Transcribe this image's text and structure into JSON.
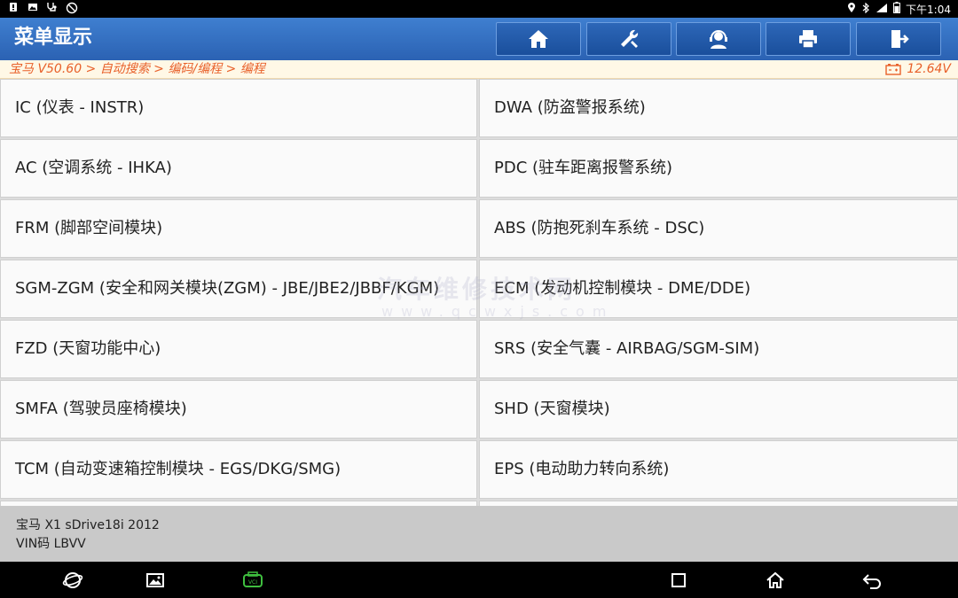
{
  "statusbar": {
    "left_icons": [
      "alert-icon",
      "image-icon",
      "stethoscope-icon",
      "no-disturb-icon"
    ],
    "time": "下午1:04"
  },
  "header": {
    "title": "菜单显示",
    "buttons": [
      {
        "name": "home-button",
        "icon": "home-icon"
      },
      {
        "name": "diagnose-tools-button",
        "icon": "tools-icon"
      },
      {
        "name": "support-button",
        "icon": "headset-icon"
      },
      {
        "name": "print-button",
        "icon": "printer-icon"
      },
      {
        "name": "exit-button",
        "icon": "exit-icon"
      }
    ]
  },
  "breadcrumb": {
    "path": "宝马 V50.60 > 自动搜索 > 编码/编程 > 编程",
    "voltage": "12.64V"
  },
  "menu": {
    "items": [
      {
        "left": "IC (仪表 - INSTR)",
        "right": "DWA (防盗警报系统)"
      },
      {
        "left": "AC (空调系统 - IHKA)",
        "right": "PDC (驻车距离报警系统)"
      },
      {
        "left": "FRM (脚部空间模块)",
        "right": "ABS (防抱死刹车系统 - DSC)"
      },
      {
        "left": "SGM-ZGM (安全和网关模块(ZGM) - JBE/JBE2/JBBF/KGM)",
        "right": "ECM (发动机控制模块 - DME/DDE)"
      },
      {
        "left": "FZD (天窗功能中心)",
        "right": "SRS (安全气囊 - AIRBAG/SGM-SIM)"
      },
      {
        "left": "SMFA (驾驶员座椅模块)",
        "right": "SHD (天窗模块)"
      },
      {
        "left": "TCM (自动变速箱控制模块 - EGS/DKG/SMG)",
        "right": "EPS (电动助力转向系统)"
      }
    ]
  },
  "watermark": {
    "line1": "汽车维修技术网",
    "line2": "www.qcwxjs.com"
  },
  "vehicle": {
    "model": "宝马 X1 sDrive18i 2012",
    "vin": "VIN码 LBVV"
  },
  "colors": {
    "header": "#2b62b3",
    "breadcrumb_text": "#e8602a",
    "vci_icon": "#3fbf3f"
  }
}
